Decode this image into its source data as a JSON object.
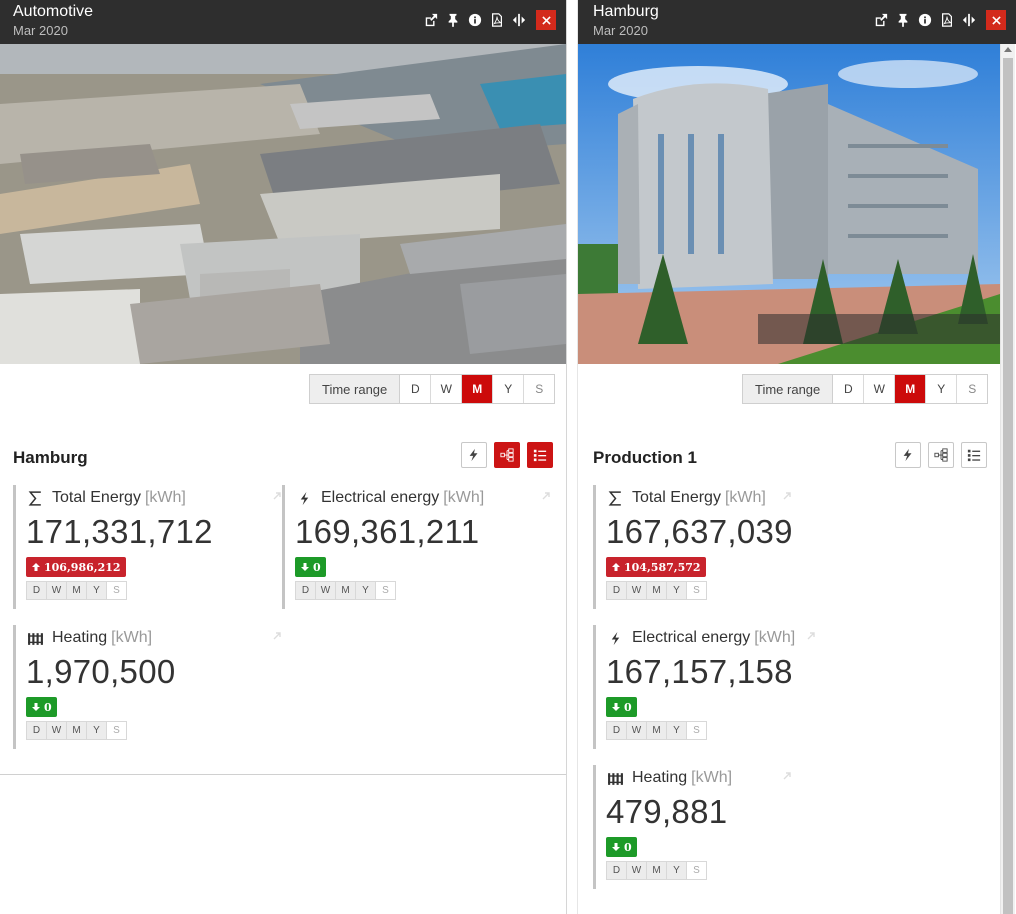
{
  "panel1": {
    "title": "Automotive",
    "subtitle": "Mar 2020",
    "time_range": {
      "label": "Time range",
      "options": [
        "D",
        "W",
        "M",
        "Y",
        "S"
      ],
      "selected": "M"
    },
    "section_title": "Hamburg",
    "cards": [
      {
        "title": "Total Energy",
        "unit": "[kWh]",
        "icon": "sigma-icon",
        "value": "171,331,712",
        "badge": "106,986,212",
        "badge_dir": "up",
        "badge_color": "#c8232c",
        "periods": [
          "D",
          "W",
          "M",
          "Y",
          "S"
        ]
      },
      {
        "title": "Electrical energy",
        "unit": "[kWh]",
        "icon": "lightning-icon",
        "value": "169,361,211",
        "badge": "0",
        "badge_dir": "down",
        "badge_color": "#1d9a28",
        "periods": [
          "D",
          "W",
          "M",
          "Y",
          "S"
        ]
      },
      {
        "title": "Heating",
        "unit": "[kWh]",
        "icon": "radiator-icon",
        "value": "1,970,500",
        "badge": "0",
        "badge_dir": "down",
        "badge_color": "#1d9a28",
        "periods": [
          "D",
          "W",
          "M",
          "Y",
          "S"
        ]
      }
    ]
  },
  "panel2": {
    "title": "Hamburg",
    "subtitle": "Mar 2020",
    "time_range": {
      "label": "Time range",
      "options": [
        "D",
        "W",
        "M",
        "Y",
        "S"
      ],
      "selected": "M"
    },
    "section_title": "Production 1",
    "cards": [
      {
        "title": "Total Energy",
        "unit": "[kWh]",
        "icon": "sigma-icon",
        "value": "167,637,039",
        "badge": "104,587,572",
        "badge_dir": "up",
        "badge_color": "#c8232c",
        "periods": [
          "D",
          "W",
          "M",
          "Y",
          "S"
        ]
      },
      {
        "title": "Electrical energy",
        "unit": "[kWh]",
        "icon": "lightning-icon",
        "value": "167,157,158",
        "badge": "0",
        "badge_dir": "down",
        "badge_color": "#1d9a28",
        "periods": [
          "D",
          "W",
          "M",
          "Y",
          "S"
        ]
      },
      {
        "title": "Heating",
        "unit": "[kWh]",
        "icon": "radiator-icon",
        "value": "479,881",
        "badge": "0",
        "badge_dir": "down",
        "badge_color": "#1d9a28",
        "periods": [
          "D",
          "W",
          "M",
          "Y",
          "S"
        ]
      }
    ]
  },
  "colors": {
    "header_bg": "#2e2e2e",
    "accent_red": "#cc0a0a",
    "close_red": "#d32a1c",
    "badge_green": "#1d9a28"
  }
}
